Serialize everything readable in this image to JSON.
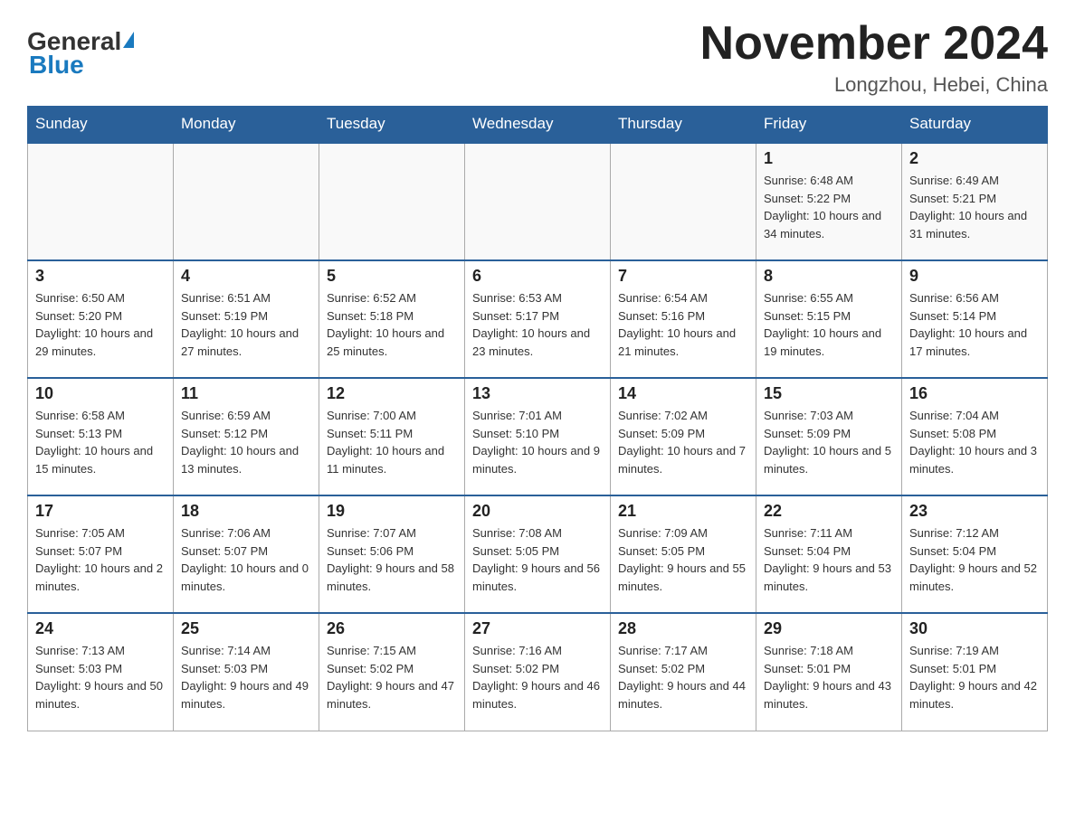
{
  "header": {
    "logo_general": "General",
    "logo_blue": "Blue",
    "month_title": "November 2024",
    "location": "Longzhou, Hebei, China"
  },
  "weekdays": [
    "Sunday",
    "Monday",
    "Tuesday",
    "Wednesday",
    "Thursday",
    "Friday",
    "Saturday"
  ],
  "weeks": [
    [
      {
        "day": "",
        "info": ""
      },
      {
        "day": "",
        "info": ""
      },
      {
        "day": "",
        "info": ""
      },
      {
        "day": "",
        "info": ""
      },
      {
        "day": "",
        "info": ""
      },
      {
        "day": "1",
        "info": "Sunrise: 6:48 AM\nSunset: 5:22 PM\nDaylight: 10 hours and 34 minutes."
      },
      {
        "day": "2",
        "info": "Sunrise: 6:49 AM\nSunset: 5:21 PM\nDaylight: 10 hours and 31 minutes."
      }
    ],
    [
      {
        "day": "3",
        "info": "Sunrise: 6:50 AM\nSunset: 5:20 PM\nDaylight: 10 hours and 29 minutes."
      },
      {
        "day": "4",
        "info": "Sunrise: 6:51 AM\nSunset: 5:19 PM\nDaylight: 10 hours and 27 minutes."
      },
      {
        "day": "5",
        "info": "Sunrise: 6:52 AM\nSunset: 5:18 PM\nDaylight: 10 hours and 25 minutes."
      },
      {
        "day": "6",
        "info": "Sunrise: 6:53 AM\nSunset: 5:17 PM\nDaylight: 10 hours and 23 minutes."
      },
      {
        "day": "7",
        "info": "Sunrise: 6:54 AM\nSunset: 5:16 PM\nDaylight: 10 hours and 21 minutes."
      },
      {
        "day": "8",
        "info": "Sunrise: 6:55 AM\nSunset: 5:15 PM\nDaylight: 10 hours and 19 minutes."
      },
      {
        "day": "9",
        "info": "Sunrise: 6:56 AM\nSunset: 5:14 PM\nDaylight: 10 hours and 17 minutes."
      }
    ],
    [
      {
        "day": "10",
        "info": "Sunrise: 6:58 AM\nSunset: 5:13 PM\nDaylight: 10 hours and 15 minutes."
      },
      {
        "day": "11",
        "info": "Sunrise: 6:59 AM\nSunset: 5:12 PM\nDaylight: 10 hours and 13 minutes."
      },
      {
        "day": "12",
        "info": "Sunrise: 7:00 AM\nSunset: 5:11 PM\nDaylight: 10 hours and 11 minutes."
      },
      {
        "day": "13",
        "info": "Sunrise: 7:01 AM\nSunset: 5:10 PM\nDaylight: 10 hours and 9 minutes."
      },
      {
        "day": "14",
        "info": "Sunrise: 7:02 AM\nSunset: 5:09 PM\nDaylight: 10 hours and 7 minutes."
      },
      {
        "day": "15",
        "info": "Sunrise: 7:03 AM\nSunset: 5:09 PM\nDaylight: 10 hours and 5 minutes."
      },
      {
        "day": "16",
        "info": "Sunrise: 7:04 AM\nSunset: 5:08 PM\nDaylight: 10 hours and 3 minutes."
      }
    ],
    [
      {
        "day": "17",
        "info": "Sunrise: 7:05 AM\nSunset: 5:07 PM\nDaylight: 10 hours and 2 minutes."
      },
      {
        "day": "18",
        "info": "Sunrise: 7:06 AM\nSunset: 5:07 PM\nDaylight: 10 hours and 0 minutes."
      },
      {
        "day": "19",
        "info": "Sunrise: 7:07 AM\nSunset: 5:06 PM\nDaylight: 9 hours and 58 minutes."
      },
      {
        "day": "20",
        "info": "Sunrise: 7:08 AM\nSunset: 5:05 PM\nDaylight: 9 hours and 56 minutes."
      },
      {
        "day": "21",
        "info": "Sunrise: 7:09 AM\nSunset: 5:05 PM\nDaylight: 9 hours and 55 minutes."
      },
      {
        "day": "22",
        "info": "Sunrise: 7:11 AM\nSunset: 5:04 PM\nDaylight: 9 hours and 53 minutes."
      },
      {
        "day": "23",
        "info": "Sunrise: 7:12 AM\nSunset: 5:04 PM\nDaylight: 9 hours and 52 minutes."
      }
    ],
    [
      {
        "day": "24",
        "info": "Sunrise: 7:13 AM\nSunset: 5:03 PM\nDaylight: 9 hours and 50 minutes."
      },
      {
        "day": "25",
        "info": "Sunrise: 7:14 AM\nSunset: 5:03 PM\nDaylight: 9 hours and 49 minutes."
      },
      {
        "day": "26",
        "info": "Sunrise: 7:15 AM\nSunset: 5:02 PM\nDaylight: 9 hours and 47 minutes."
      },
      {
        "day": "27",
        "info": "Sunrise: 7:16 AM\nSunset: 5:02 PM\nDaylight: 9 hours and 46 minutes."
      },
      {
        "day": "28",
        "info": "Sunrise: 7:17 AM\nSunset: 5:02 PM\nDaylight: 9 hours and 44 minutes."
      },
      {
        "day": "29",
        "info": "Sunrise: 7:18 AM\nSunset: 5:01 PM\nDaylight: 9 hours and 43 minutes."
      },
      {
        "day": "30",
        "info": "Sunrise: 7:19 AM\nSunset: 5:01 PM\nDaylight: 9 hours and 42 minutes."
      }
    ]
  ]
}
